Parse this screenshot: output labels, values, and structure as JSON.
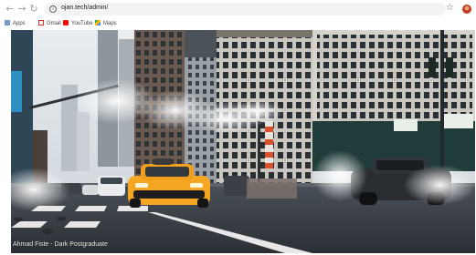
{
  "browser": {
    "url": "ojan.tech/admin/",
    "nav": {
      "back_icon": "arrow-left-icon",
      "forward_icon": "arrow-right-icon",
      "reload_icon": "reload-icon"
    },
    "bookmarks": [
      {
        "label": "Apps",
        "icon": "apps-grid-icon"
      },
      {
        "label": "Gmail",
        "icon": "gmail-icon"
      },
      {
        "label": "YouTube",
        "icon": "youtube-icon"
      },
      {
        "label": "Maps",
        "icon": "maps-icon"
      }
    ]
  },
  "page": {
    "caption": "Ahmad Fiste - Dark Postgraduate",
    "scene": "city-street-taxi-steam"
  },
  "colors": {
    "taxi": "#f5a623",
    "sky": "#dfe4e8",
    "road": "#3a3f45"
  }
}
